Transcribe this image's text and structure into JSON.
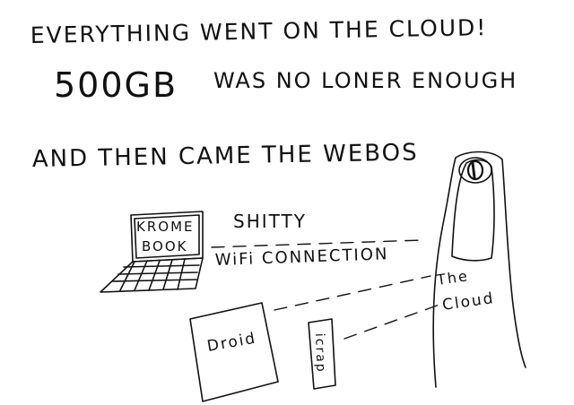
{
  "lines": {
    "line1": "EVERYTHING WENT ON THE CLOUD!",
    "line2_size": "500GB",
    "line2_rest": "WAS NO LONER ENOUGH",
    "line3": "AND THEN CAME THE WEBOS"
  },
  "laptop": {
    "screen_line1": "KROME",
    "screen_line2": "BOOK"
  },
  "connection": {
    "line1": "SHITTY",
    "line2": "WiFi CONNECTION"
  },
  "devices": {
    "phone_label": "Droid",
    "stick_label": "icrap"
  },
  "cloud": {
    "line1": "The",
    "line2": "Cloud"
  }
}
